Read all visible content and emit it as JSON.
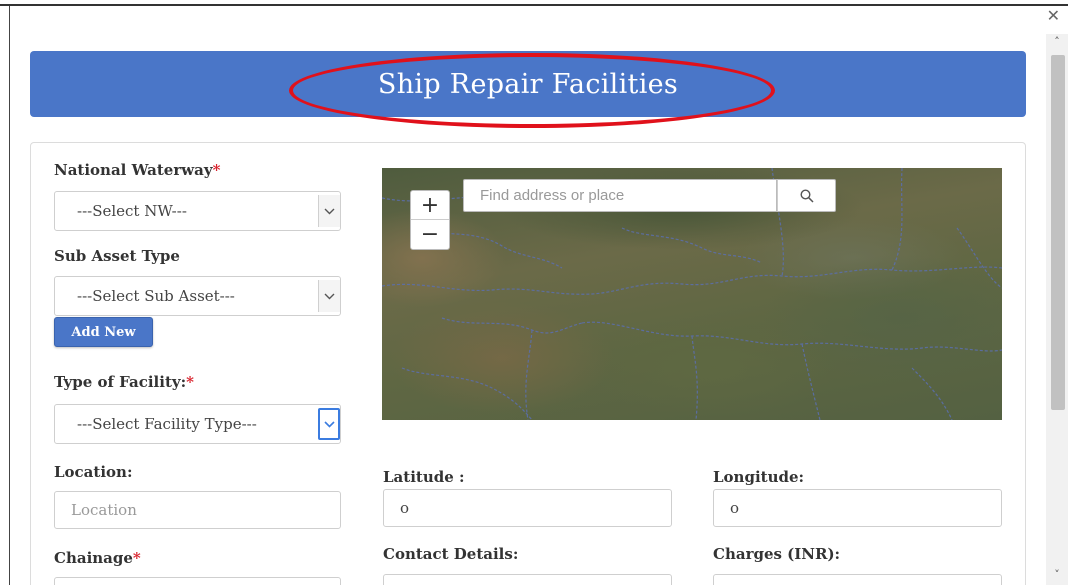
{
  "window": {
    "close_glyph": "✕",
    "scroll_up_glyph": "˄",
    "scroll_down_glyph": "˅"
  },
  "header": {
    "title": "Ship Repair Facilities",
    "highlight_color": "#e0111b",
    "bar_color": "#4a76c8"
  },
  "form": {
    "national_waterway": {
      "label": "National Waterway",
      "required_mark": "*",
      "selected": "---Select NW---"
    },
    "sub_asset_type": {
      "label": "Sub Asset Type",
      "selected": "---Select Sub Asset---",
      "add_button": "Add New"
    },
    "type_of_facility": {
      "label": "Type of Facility:",
      "required_mark": "*",
      "selected": "---Select Facility Type---"
    },
    "location": {
      "label": "Location:",
      "placeholder": "Location"
    },
    "latitude": {
      "label": "Latitude :",
      "value": "o"
    },
    "longitude": {
      "label": "Longitude:",
      "value": "o"
    },
    "chainage": {
      "label": "Chainage",
      "required_mark": "*"
    },
    "contact_details": {
      "label": "Contact Details:"
    },
    "charges": {
      "label": "Charges (INR):"
    }
  },
  "map": {
    "search_placeholder": "Find address or place",
    "zoom_in": "+",
    "zoom_out": "−",
    "search_icon": "search-icon",
    "border_color": "#5b6fb0"
  }
}
